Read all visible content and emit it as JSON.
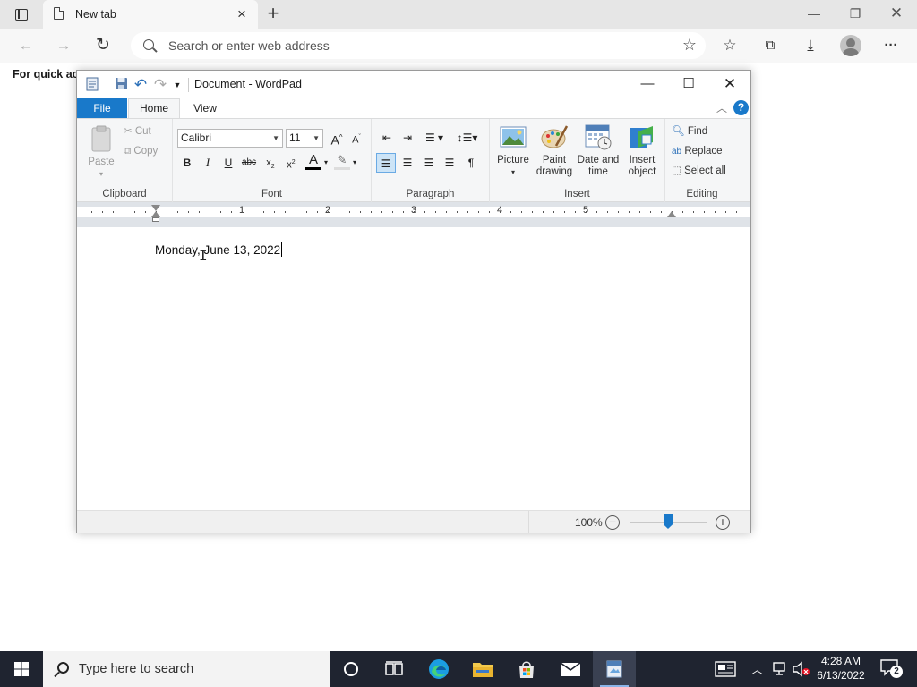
{
  "browser": {
    "tab_title": "New tab",
    "address_placeholder": "Search or enter web address",
    "favorites_hint": "For quick acc"
  },
  "wordpad": {
    "title": "Document - WordPad",
    "tabs": {
      "file": "File",
      "home": "Home",
      "view": "View"
    },
    "clipboard": {
      "paste": "Paste",
      "cut": "Cut",
      "copy": "Copy",
      "label": "Clipboard"
    },
    "font": {
      "family": "Calibri",
      "size": "11",
      "label": "Font"
    },
    "paragraph": {
      "label": "Paragraph"
    },
    "insert": {
      "picture": "Picture",
      "paint_line1": "Paint",
      "paint_line2": "drawing",
      "datetime_line1": "Date and",
      "datetime_line2": "time",
      "object_line1": "Insert",
      "object_line2": "object",
      "label": "Insert"
    },
    "editing": {
      "find": "Find",
      "replace": "Replace",
      "select_all": "Select all",
      "label": "Editing"
    },
    "ruler": {
      "numbers": [
        "1",
        "2",
        "3",
        "4",
        "5"
      ]
    },
    "document_text": "Monday, June 13, 2022",
    "zoom": "100%"
  },
  "taskbar": {
    "search_placeholder": "Type here to search",
    "time": "4:28 AM",
    "date": "6/13/2022",
    "notifications": "2"
  },
  "colors": {
    "accent": "#1979ca",
    "taskbar": "#1f2430",
    "ribbon": "#f5f6f7"
  }
}
